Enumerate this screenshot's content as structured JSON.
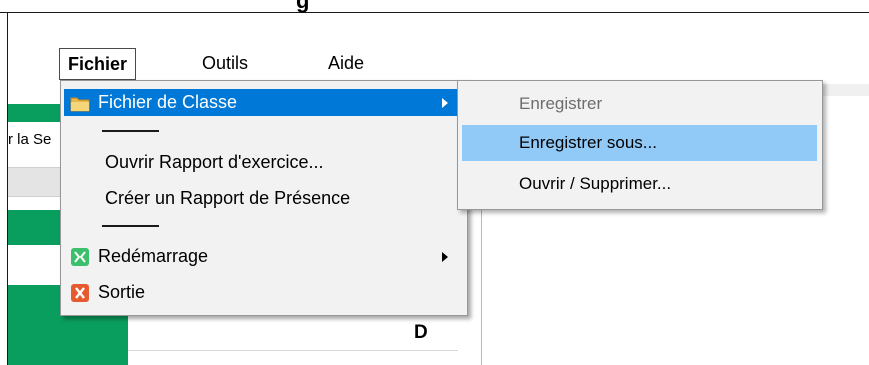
{
  "window": {
    "title": "...g..."
  },
  "menubar": {
    "items": [
      {
        "label": "Fichier"
      },
      {
        "label": "Outils"
      },
      {
        "label": "Aide"
      }
    ]
  },
  "background": {
    "left_label": "r la Se",
    "column_header": "D",
    "colors": {
      "green": "#0a9e5e",
      "gray": "#e8e8e8"
    }
  },
  "dropdown": {
    "items": [
      {
        "label": "Fichier de Classe",
        "icon": "folder-icon",
        "submenu": true,
        "highlighted": true
      },
      {
        "label": "Ouvrir Rapport d'exercice..."
      },
      {
        "label": "Créer un Rapport de Présence"
      },
      {
        "label": "Redémarrage",
        "icon": "restart-icon",
        "submenu": true
      },
      {
        "label": "Sortie",
        "icon": "exit-icon"
      }
    ]
  },
  "submenu": {
    "items": [
      {
        "label": "Enregistrer",
        "disabled": true
      },
      {
        "label": "Enregistrer sous...",
        "hover": true
      },
      {
        "label": "Ouvrir / Supprimer..."
      }
    ]
  },
  "colors": {
    "highlight": "#0078d7",
    "submenu_hover": "#91c9f7",
    "menu_bg": "#f2f2f2"
  }
}
